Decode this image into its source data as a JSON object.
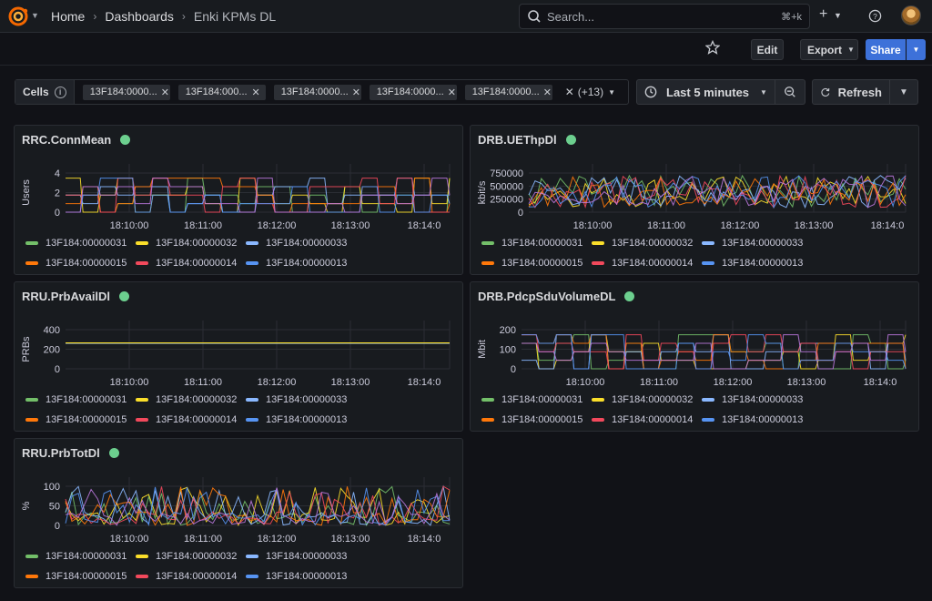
{
  "header": {
    "breadcrumb": [
      "Home",
      "Dashboards",
      "Enki KPMs DL"
    ],
    "search_placeholder": "Search...",
    "search_shortcut": "⌘+k",
    "add_icon": "plus-icon",
    "help_icon": "help-icon"
  },
  "toolbar": {
    "edit_label": "Edit",
    "export_label": "Export",
    "share_label": "Share"
  },
  "variables": {
    "label": "Cells",
    "chips": [
      "13F184:0000...",
      "13F184:000...",
      "13F184:0000...",
      "13F184:0000...",
      "13F184:0000..."
    ],
    "more": "(+13)"
  },
  "time": {
    "range_label": "Last 5 minutes",
    "refresh_label": "Refresh"
  },
  "colors": {
    "series": [
      "#73bf69",
      "#fade2a",
      "#8ab8ff",
      "#ff780a",
      "#f2495c",
      "#5794f2",
      "#b877d9"
    ]
  },
  "legend": [
    "13F184:00000031",
    "13F184:00000032",
    "13F184:00000033",
    "13F184:00000015",
    "13F184:00000014",
    "13F184:00000013"
  ],
  "panels": [
    {
      "title": "RRC.ConnMean",
      "ylabel": "Users",
      "yticks": [
        "4",
        "2",
        "0"
      ],
      "xticks": [
        "18:10:00",
        "18:11:00",
        "18:12:00",
        "18:13:00",
        "18:14:0"
      ],
      "kind": "steps",
      "ymax": 4
    },
    {
      "title": "DRB.UEThpDl",
      "ylabel": "kbit/s",
      "yticks": [
        "750000",
        "500000",
        "250000",
        "0"
      ],
      "xticks": [
        "18:10:00",
        "18:11:00",
        "18:12:00",
        "18:13:00",
        "18:14:0"
      ],
      "kind": "noise",
      "ymax": 750000
    },
    {
      "title": "RRU.PrbAvailDl",
      "ylabel": "PRBs",
      "yticks": [
        "400",
        "200",
        "0"
      ],
      "xticks": [
        "18:10:00",
        "18:11:00",
        "18:12:00",
        "18:13:00",
        "18:14:0"
      ],
      "kind": "flat",
      "ymax": 400
    },
    {
      "title": "DRB.PdcpSduVolumeDL",
      "ylabel": "Mbit",
      "yticks": [
        "200",
        "100",
        "0"
      ],
      "xticks": [
        "18:10:00",
        "18:11:00",
        "18:12:00",
        "18:13:00",
        "18:14:0"
      ],
      "kind": "steps",
      "ymax": 200
    },
    {
      "title": "RRU.PrbTotDl",
      "ylabel": "%",
      "yticks": [
        "100",
        "50",
        "0"
      ],
      "xticks": [
        "18:10:00",
        "18:11:00",
        "18:12:00",
        "18:13:00",
        "18:14:0"
      ],
      "kind": "spikes",
      "ymax": 100
    }
  ]
}
